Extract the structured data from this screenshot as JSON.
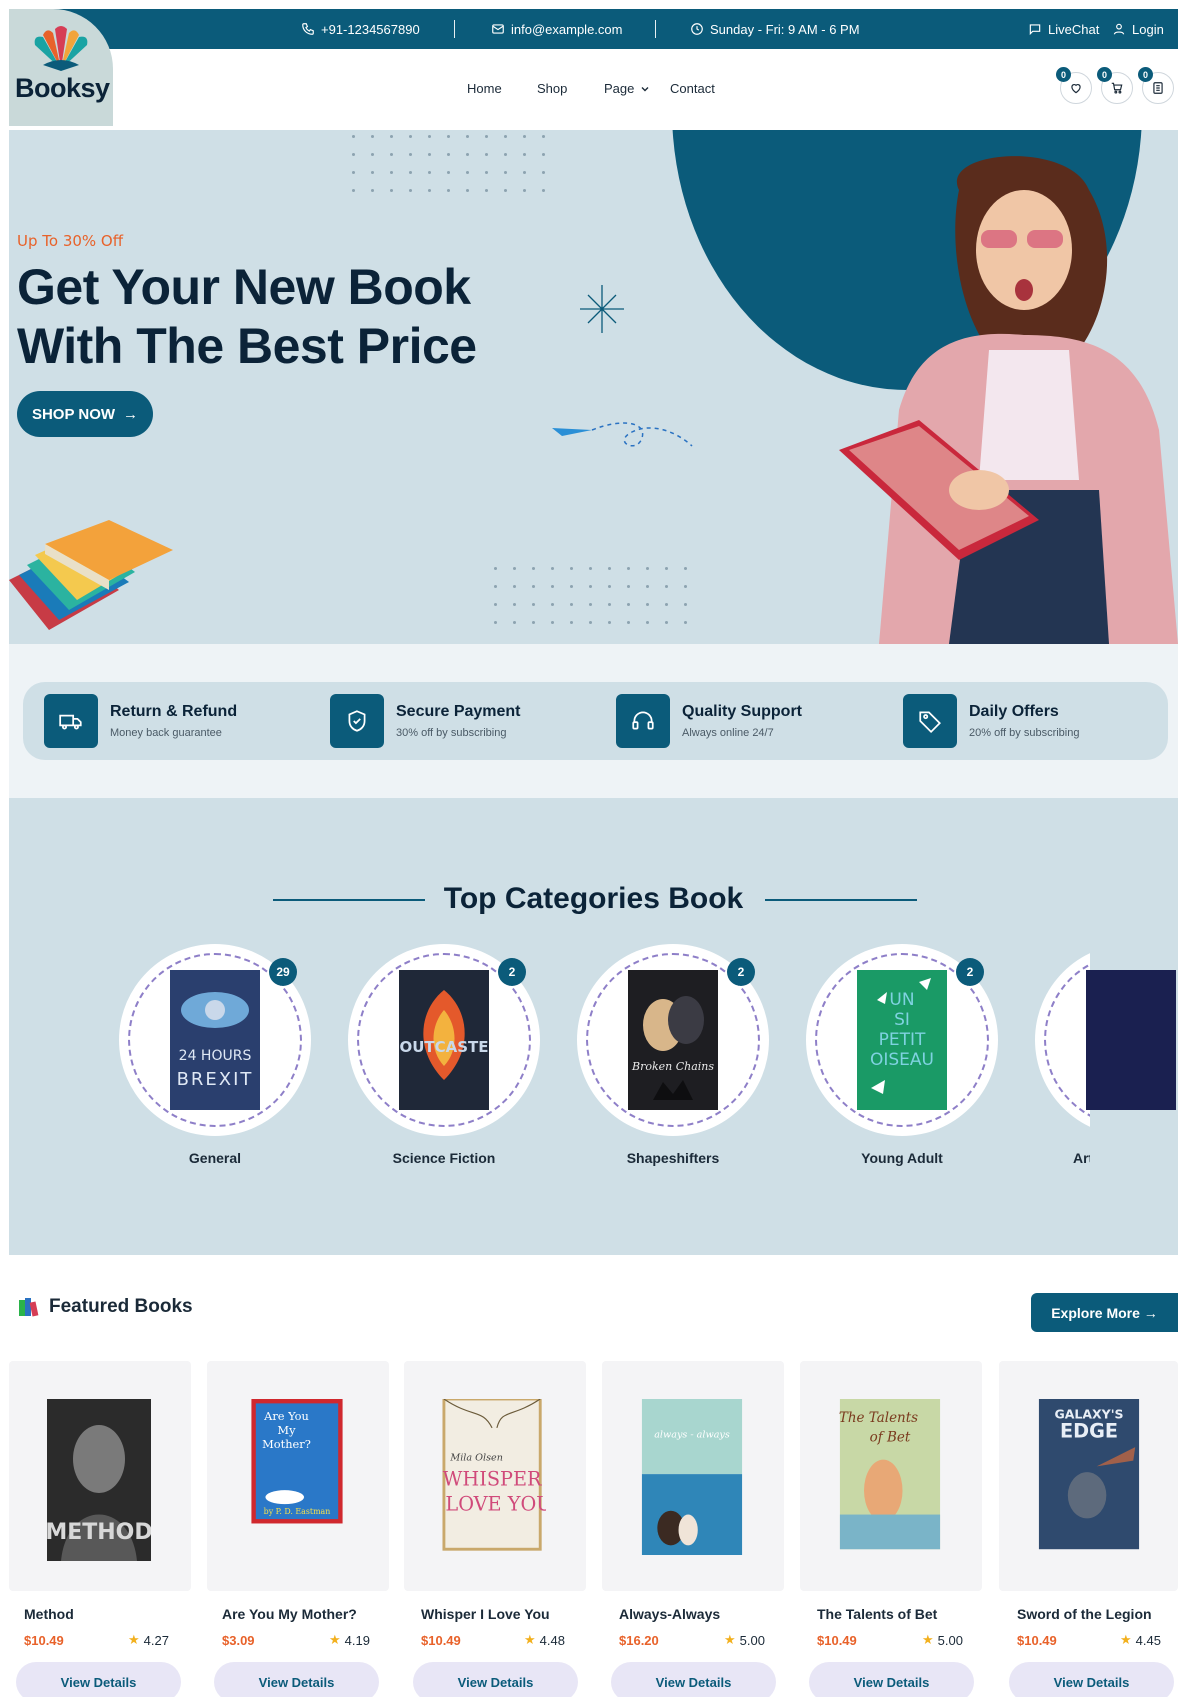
{
  "topbar": {
    "phone": "+91-1234567890",
    "email": "info@example.com",
    "hours": "Sunday - Fri: 9 AM - 6 PM",
    "livechat": "LiveChat",
    "login": "Login"
  },
  "logo": {
    "name": "Booksy"
  },
  "nav": {
    "items": [
      "Home",
      "Shop",
      "Page",
      "Contact"
    ],
    "wishlist_count": "0",
    "cart_count": "0",
    "compare_count": "0"
  },
  "hero": {
    "offer": "Up To 30% Off",
    "title_line1": "Get Your New Book",
    "title_line2": "With The Best Price",
    "cta": "SHOP NOW"
  },
  "features": [
    {
      "title": "Return & Refund",
      "subtitle": "Money back guarantee"
    },
    {
      "title": "Secure Payment",
      "subtitle": "30% off by subscribing"
    },
    {
      "title": "Quality Support",
      "subtitle": "Always online 24/7"
    },
    {
      "title": "Daily Offers",
      "subtitle": "20% off by subscribing"
    }
  ],
  "categories": {
    "title": "Top Categories Book",
    "items": [
      {
        "label": "General",
        "count": "29",
        "cover_color": "#2a3f6e",
        "cover_text": "24 HOURS BREXIT"
      },
      {
        "label": "Science Fiction",
        "count": "2",
        "cover_color": "#1f2838",
        "cover_text": "OUTCASTE"
      },
      {
        "label": "Shapeshifters",
        "count": "2",
        "cover_color": "#1e1e22",
        "cover_text": "Broken Chains"
      },
      {
        "label": "Young Adult",
        "count": "2",
        "cover_color": "#1a9a66",
        "cover_text": "UN SI PETIT OISEAU"
      },
      {
        "label": "Arti",
        "count": "",
        "cover_color": "#1a2050",
        "cover_text": ""
      }
    ]
  },
  "featured": {
    "title": "Featured Books",
    "explore": "Explore More →",
    "view_label": "View Details",
    "books": [
      {
        "title": "Method",
        "price": "$10.49",
        "rating": "4.27",
        "cover": "#2b2b2b",
        "cover_text": "METHOD"
      },
      {
        "title": "Are You My Mother?",
        "price": "$3.09",
        "rating": "4.19",
        "cover": "#2a78c8",
        "cover_text": "Are You My Mother?"
      },
      {
        "title": "Whisper I Love You",
        "price": "$10.49",
        "rating": "4.48",
        "cover": "#f2ede2",
        "cover_text": "WHISPER I LOVE YOU"
      },
      {
        "title": "Always-Always",
        "price": "$16.20",
        "rating": "5.00",
        "cover": "#5fb3c6",
        "cover_text": "always"
      },
      {
        "title": "The Talents of Bet",
        "price": "$10.49",
        "rating": "5.00",
        "cover": "#c8d8a6",
        "cover_text": "The Talents of Bet"
      },
      {
        "title": "Sword of the Legion",
        "price": "$10.49",
        "rating": "4.45",
        "cover": "#2f4a6e",
        "cover_text": "GALAXY'S EDGE"
      }
    ]
  },
  "colors": {
    "primary": "#0b5b7a",
    "accent": "#e8622a",
    "hero_bg": "#cfdfe6"
  }
}
